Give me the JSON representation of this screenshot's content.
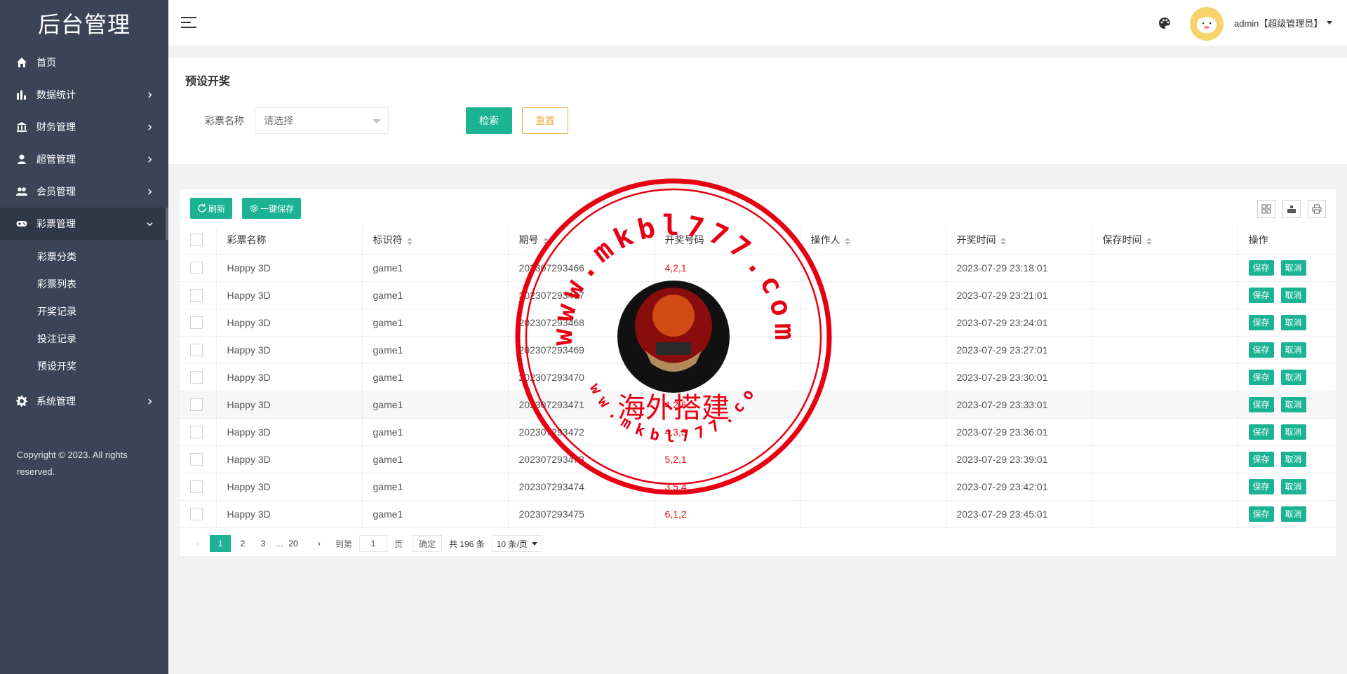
{
  "app": {
    "title": "后台管理"
  },
  "sidebar": {
    "items": [
      {
        "label": "首页",
        "icon": "home-icon"
      },
      {
        "label": "数据统计",
        "icon": "bar-chart-icon"
      },
      {
        "label": "财务管理",
        "icon": "bank-icon"
      },
      {
        "label": "超管管理",
        "icon": "user-icon"
      },
      {
        "label": "会员管理",
        "icon": "users-icon"
      },
      {
        "label": "彩票管理",
        "icon": "gamepad-icon"
      },
      {
        "label": "系统管理",
        "icon": "gear-icon"
      }
    ],
    "subitems": [
      "彩票分类",
      "彩票列表",
      "开奖记录",
      "投注记录",
      "预设开奖"
    ],
    "copyright": "Copyright © 2023. All rights reserved."
  },
  "header": {
    "user": "admin【超级管理员】"
  },
  "search": {
    "title": "预设开奖",
    "label": "彩票名称",
    "placeholder": "请选择",
    "search_btn": "检索",
    "reset_btn": "重置"
  },
  "toolbar": {
    "refresh": "刷新",
    "save_all": "一键保存"
  },
  "table": {
    "headers": [
      "彩票名称",
      "标识符",
      "期号",
      "开奖号码",
      "操作人",
      "开奖时间",
      "保存时间",
      "操作"
    ],
    "rows": [
      {
        "name": "Happy 3D",
        "id": "game1",
        "period": "202307293466",
        "nums": "4,2,1",
        "op": "",
        "time": "2023-07-29 23:18:01",
        "saved": ""
      },
      {
        "name": "Happy 3D",
        "id": "game1",
        "period": "202307293467",
        "nums": "",
        "op": "",
        "time": "2023-07-29 23:21:01",
        "saved": ""
      },
      {
        "name": "Happy 3D",
        "id": "game1",
        "period": "202307293468",
        "nums": "",
        "op": "",
        "time": "2023-07-29 23:24:01",
        "saved": ""
      },
      {
        "name": "Happy 3D",
        "id": "game1",
        "period": "202307293469",
        "nums": "",
        "op": "",
        "time": "2023-07-29 23:27:01",
        "saved": ""
      },
      {
        "name": "Happy 3D",
        "id": "game1",
        "period": "202307293470",
        "nums": "",
        "op": "",
        "time": "2023-07-29 23:30:01",
        "saved": ""
      },
      {
        "name": "Happy 3D",
        "id": "game1",
        "period": "202307293471",
        "nums": "4,2,6",
        "op": "",
        "time": "2023-07-29 23:33:01",
        "saved": ""
      },
      {
        "name": "Happy 3D",
        "id": "game1",
        "period": "202307293472",
        "nums": "4,3,3",
        "op": "",
        "time": "2023-07-29 23:36:01",
        "saved": ""
      },
      {
        "name": "Happy 3D",
        "id": "game1",
        "period": "202307293473",
        "nums": "5,2,1",
        "op": "",
        "time": "2023-07-29 23:39:01",
        "saved": ""
      },
      {
        "name": "Happy 3D",
        "id": "game1",
        "period": "202307293474",
        "nums": "3,5,4",
        "op": "",
        "time": "2023-07-29 23:42:01",
        "saved": ""
      },
      {
        "name": "Happy 3D",
        "id": "game1",
        "period": "202307293475",
        "nums": "6,1,2",
        "op": "",
        "time": "2023-07-29 23:45:01",
        "saved": ""
      }
    ],
    "save_label": "保存",
    "cancel_label": "取消"
  },
  "pagination": {
    "pages": [
      "1",
      "2",
      "3",
      "…",
      "20"
    ],
    "goto_label": "到第",
    "page_value": "1",
    "page_unit": "页",
    "confirm": "确定",
    "total": "共 196 条",
    "limit": "10 条/页"
  },
  "watermark": {
    "url": "www.mkbl777.com",
    "text": "海外搭建"
  },
  "colors": {
    "sidebar": "#3a4456",
    "accent": "#1bb394",
    "warning": "#f0ad4e",
    "number": "#e81414",
    "stamp": "#e60012"
  }
}
